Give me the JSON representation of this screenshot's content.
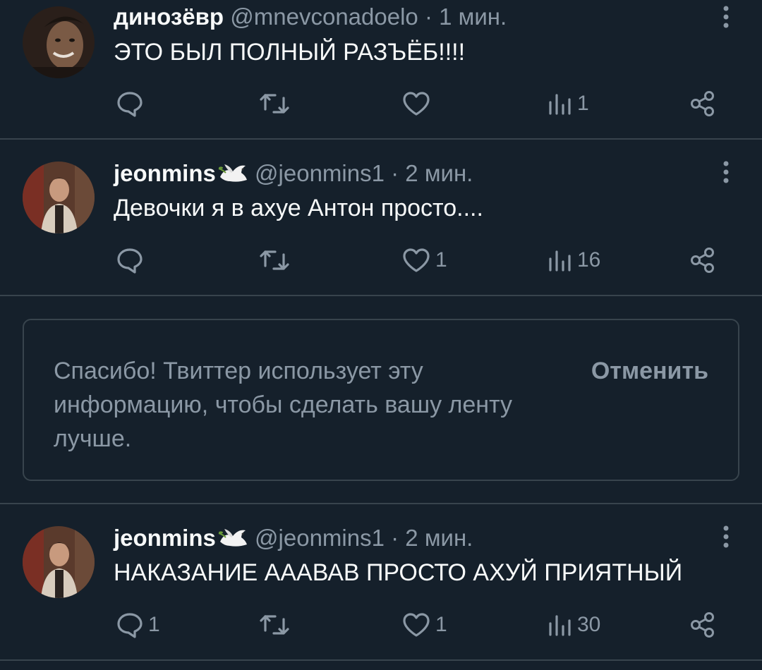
{
  "tweets": [
    {
      "name": "динозёвр",
      "handle": "@mnevconadoelo",
      "dot": "·",
      "time": "1 мин.",
      "text": "ЭТО БЫЛ ПОЛНЫЙ РАЗЪЁБ!!!!",
      "replies": "",
      "retweets": "",
      "likes": "",
      "views": "1"
    },
    {
      "name": "jeonmins",
      "handle": "@jeonmins1",
      "dot": "·",
      "time": "2 мин.",
      "text": "Девочки я в ахуе Антон просто....",
      "replies": "",
      "retweets": "",
      "likes": "1",
      "views": "16"
    },
    {
      "name": "jeonmins",
      "handle": "@jeonmins1",
      "dot": "·",
      "time": "2 мин.",
      "text": "НАКАЗАНИЕ АААВАВ ПРОСТО АХУЙ ПРИЯТНЫЙ",
      "replies": "1",
      "retweets": "",
      "likes": "1",
      "views": "30"
    }
  ],
  "notice": {
    "text": "Спасибо! Твиттер использует эту информацию, чтобы сделать вашу ленту лучше.",
    "undo_label": "Отменить"
  },
  "colors": {
    "background": "#15202b",
    "border": "#38444d",
    "muted": "#8b98a5",
    "text": "#f7f9f9"
  },
  "icons": [
    "reply-icon",
    "retweet-icon",
    "like-icon",
    "views-icon",
    "share-icon",
    "more-icon",
    "dove-emoji-icon"
  ]
}
